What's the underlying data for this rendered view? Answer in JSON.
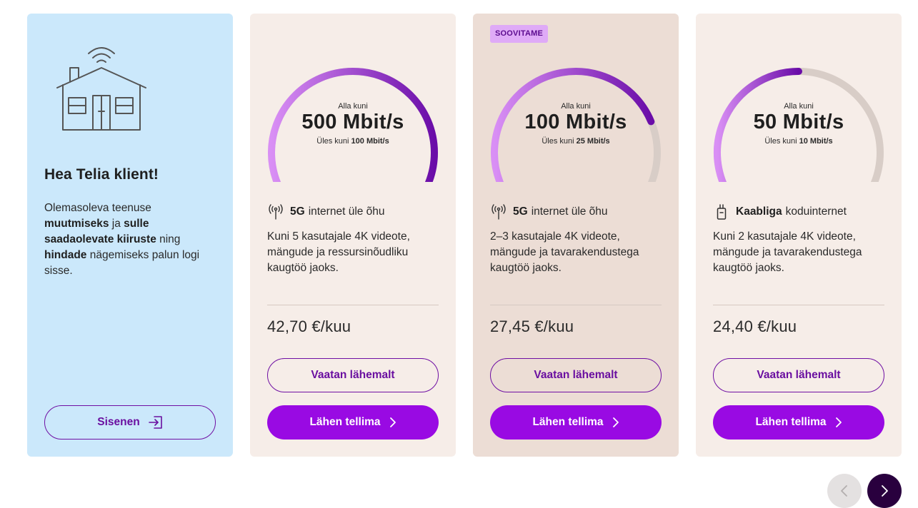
{
  "login_card": {
    "title": "Hea Telia klient!",
    "text_1": "Olemasoleva teenuse ",
    "text_b1": "muutmiseks",
    "text_2": " ja ",
    "text_b2": "sulle saadaolevate kiiruste",
    "text_3": " ning ",
    "text_b3": "hindade",
    "text_4": " nägemiseks palun logi sisse.",
    "button_label": "Sisenen"
  },
  "plans": [
    {
      "badge": "",
      "up_to_label": "Alla kuni",
      "speed": "500 Mbit/s",
      "upload_prefix": "Üles kuni ",
      "upload_speed": "100 Mbit/s",
      "fill_fraction": 1.0,
      "feature_icon": "antenna-icon",
      "feature_bold": "5G",
      "feature_text": "internet üle õhu",
      "description": "Kuni 5 kasutajale 4K videote, mängude ja ressursinõudliku kaugtöö jaoks.",
      "price": "42,70 €/kuu",
      "details_label": "Vaatan lähemalt",
      "order_label": "Lähen tellima"
    },
    {
      "badge": "SOOVITAME",
      "up_to_label": "Alla kuni",
      "speed": "100 Mbit/s",
      "upload_prefix": "Üles kuni ",
      "upload_speed": "25 Mbit/s",
      "fill_fraction": 0.75,
      "feature_icon": "antenna-icon",
      "feature_bold": "5G",
      "feature_text": "internet üle õhu",
      "description": "2–3 kasutajale 4K videote, mängude ja tavarakendustega kaugtöö jaoks.",
      "price": "27,45 €/kuu",
      "details_label": "Vaatan lähemalt",
      "order_label": "Lähen tellima"
    },
    {
      "badge": "",
      "up_to_label": "Alla kuni",
      "speed": "50 Mbit/s",
      "upload_prefix": "Üles kuni ",
      "upload_speed": "10 Mbit/s",
      "fill_fraction": 0.5,
      "feature_icon": "cable-plug-icon",
      "feature_bold": "Kaabliga",
      "feature_text": "koduinternet",
      "description": "Kuni 2 kasutajale 4K videote, mängude ja tavarakendustega kaugtöö jaoks.",
      "price": "24,40 €/kuu",
      "details_label": "Vaatan lähemalt",
      "order_label": "Lähen tellima"
    }
  ],
  "carousel": {
    "prev_icon": "chevron-left-icon",
    "next_icon": "chevron-right-icon"
  },
  "colors": {
    "brand_purple": "#990ae3",
    "gauge_start": "#d98ff5",
    "gauge_end": "#6a0ca8",
    "gauge_track": "#d8cdc7",
    "login_bg": "#cbe8fb",
    "card_bg": "#f6ede8",
    "featured_card_bg": "#ecddd5",
    "badge_bg": "#dfaaf7"
  }
}
